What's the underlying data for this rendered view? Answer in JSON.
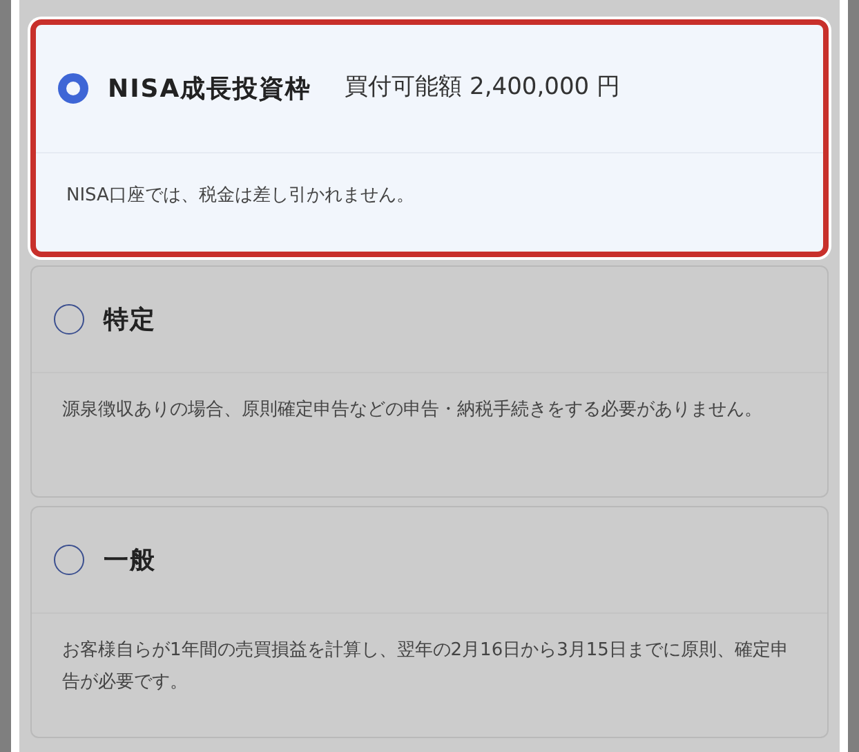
{
  "options": [
    {
      "title": "NISA成長投資枠",
      "amount": "買付可能額 2,400,000 円",
      "description": "NISA口座では、税金は差し引かれません。",
      "selected": true
    },
    {
      "title": "特定",
      "description": "源泉徴収ありの場合、原則確定申告などの申告・納税手続きをする必要がありません。",
      "selected": false
    },
    {
      "title": "一般",
      "description": "お客様自らが1年間の売買損益を計算し、翌年の2月16日から3月15日までに原則、確定申告が必要です。",
      "selected": false
    }
  ]
}
